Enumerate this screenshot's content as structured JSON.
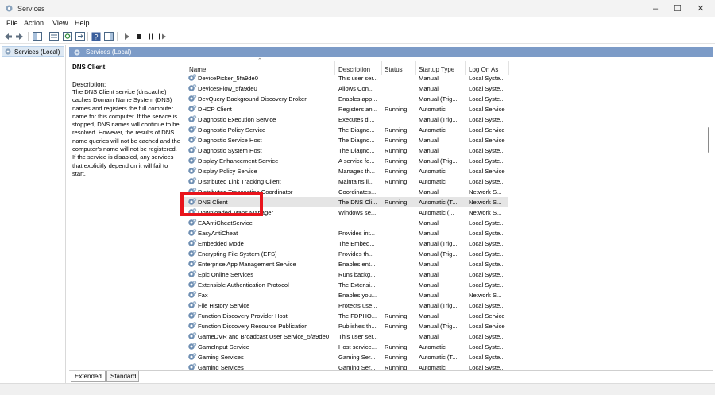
{
  "window": {
    "title": "Services"
  },
  "menu": [
    "File",
    "Action",
    "View",
    "Help"
  ],
  "tree": {
    "root_label": "Services (Local)"
  },
  "pane": {
    "header_label": "Services (Local)"
  },
  "detail": {
    "service_name": "DNS Client",
    "description_label": "Description:",
    "description_text": "The DNS Client service (dnscache) caches Domain Name System (DNS) names and registers the full computer name for this computer. If the service is stopped, DNS names will continue to be resolved. However, the results of DNS name queries will not be cached and the computer's name will not be registered. If the service is disabled, any services that explicitly depend on it will fail to start."
  },
  "columns": [
    "Name",
    "Description",
    "Status",
    "Startup Type",
    "Log On As"
  ],
  "rows": [
    {
      "name": "DevicePicker_5fa9de0",
      "desc": "This user ser...",
      "status": "",
      "startup": "Manual",
      "logon": "Local Syste..."
    },
    {
      "name": "DevicesFlow_5fa9de0",
      "desc": "Allows Con...",
      "status": "",
      "startup": "Manual",
      "logon": "Local Syste..."
    },
    {
      "name": "DevQuery Background Discovery Broker",
      "desc": "Enables app...",
      "status": "",
      "startup": "Manual (Trig...",
      "logon": "Local Syste..."
    },
    {
      "name": "DHCP Client",
      "desc": "Registers an...",
      "status": "Running",
      "startup": "Automatic",
      "logon": "Local Service"
    },
    {
      "name": "Diagnostic Execution Service",
      "desc": "Executes di...",
      "status": "",
      "startup": "Manual (Trig...",
      "logon": "Local Syste..."
    },
    {
      "name": "Diagnostic Policy Service",
      "desc": "The Diagno...",
      "status": "Running",
      "startup": "Automatic",
      "logon": "Local Service"
    },
    {
      "name": "Diagnostic Service Host",
      "desc": "The Diagno...",
      "status": "Running",
      "startup": "Manual",
      "logon": "Local Service"
    },
    {
      "name": "Diagnostic System Host",
      "desc": "The Diagno...",
      "status": "Running",
      "startup": "Manual",
      "logon": "Local Syste..."
    },
    {
      "name": "Display Enhancement Service",
      "desc": "A service fo...",
      "status": "Running",
      "startup": "Manual (Trig...",
      "logon": "Local Syste..."
    },
    {
      "name": "Display Policy Service",
      "desc": "Manages th...",
      "status": "Running",
      "startup": "Automatic",
      "logon": "Local Service"
    },
    {
      "name": "Distributed Link Tracking Client",
      "desc": "Maintains li...",
      "status": "Running",
      "startup": "Automatic",
      "logon": "Local Syste..."
    },
    {
      "name": "Distributed Transaction Coordinator",
      "desc": "Coordinates...",
      "status": "",
      "startup": "Manual",
      "logon": "Network S..."
    },
    {
      "name": "DNS Client",
      "desc": "The DNS Cli...",
      "status": "Running",
      "startup": "Automatic (T...",
      "logon": "Network S...",
      "selected": true
    },
    {
      "name": "Downloaded Maps Manager",
      "desc": "Windows se...",
      "status": "",
      "startup": "Automatic (...",
      "logon": "Network S..."
    },
    {
      "name": "EAAntiCheatService",
      "desc": "",
      "status": "",
      "startup": "Manual",
      "logon": "Local Syste..."
    },
    {
      "name": "EasyAntiCheat",
      "desc": "Provides int...",
      "status": "",
      "startup": "Manual",
      "logon": "Local Syste..."
    },
    {
      "name": "Embedded Mode",
      "desc": "The Embed...",
      "status": "",
      "startup": "Manual (Trig...",
      "logon": "Local Syste..."
    },
    {
      "name": "Encrypting File System (EFS)",
      "desc": "Provides th...",
      "status": "",
      "startup": "Manual (Trig...",
      "logon": "Local Syste..."
    },
    {
      "name": "Enterprise App Management Service",
      "desc": "Enables ent...",
      "status": "",
      "startup": "Manual",
      "logon": "Local Syste..."
    },
    {
      "name": "Epic Online Services",
      "desc": "Runs backg...",
      "status": "",
      "startup": "Manual",
      "logon": "Local Syste..."
    },
    {
      "name": "Extensible Authentication Protocol",
      "desc": "The Extensi...",
      "status": "",
      "startup": "Manual",
      "logon": "Local Syste..."
    },
    {
      "name": "Fax",
      "desc": "Enables you...",
      "status": "",
      "startup": "Manual",
      "logon": "Network S..."
    },
    {
      "name": "File History Service",
      "desc": "Protects use...",
      "status": "",
      "startup": "Manual (Trig...",
      "logon": "Local Syste..."
    },
    {
      "name": "Function Discovery Provider Host",
      "desc": "The FDPHO...",
      "status": "Running",
      "startup": "Manual",
      "logon": "Local Service"
    },
    {
      "name": "Function Discovery Resource Publication",
      "desc": "Publishes th...",
      "status": "Running",
      "startup": "Manual (Trig...",
      "logon": "Local Service"
    },
    {
      "name": "GameDVR and Broadcast User Service_5fa9de0",
      "desc": "This user ser...",
      "status": "",
      "startup": "Manual",
      "logon": "Local Syste..."
    },
    {
      "name": "GameInput Service",
      "desc": "Host service...",
      "status": "Running",
      "startup": "Automatic",
      "logon": "Local Syste..."
    },
    {
      "name": "Gaming Services",
      "desc": "Gaming Ser...",
      "status": "Running",
      "startup": "Automatic (T...",
      "logon": "Local Syste..."
    },
    {
      "name": "Gaming Services",
      "desc": "Gaming Ser...",
      "status": "Running",
      "startup": "Automatic",
      "logon": "Local Syste..."
    }
  ],
  "tabs": [
    "Extended",
    "Standard"
  ],
  "colors": {
    "pane_header": "#7c9bc7",
    "highlight": "#e8141c",
    "selected_row": "#e5e5e5"
  }
}
